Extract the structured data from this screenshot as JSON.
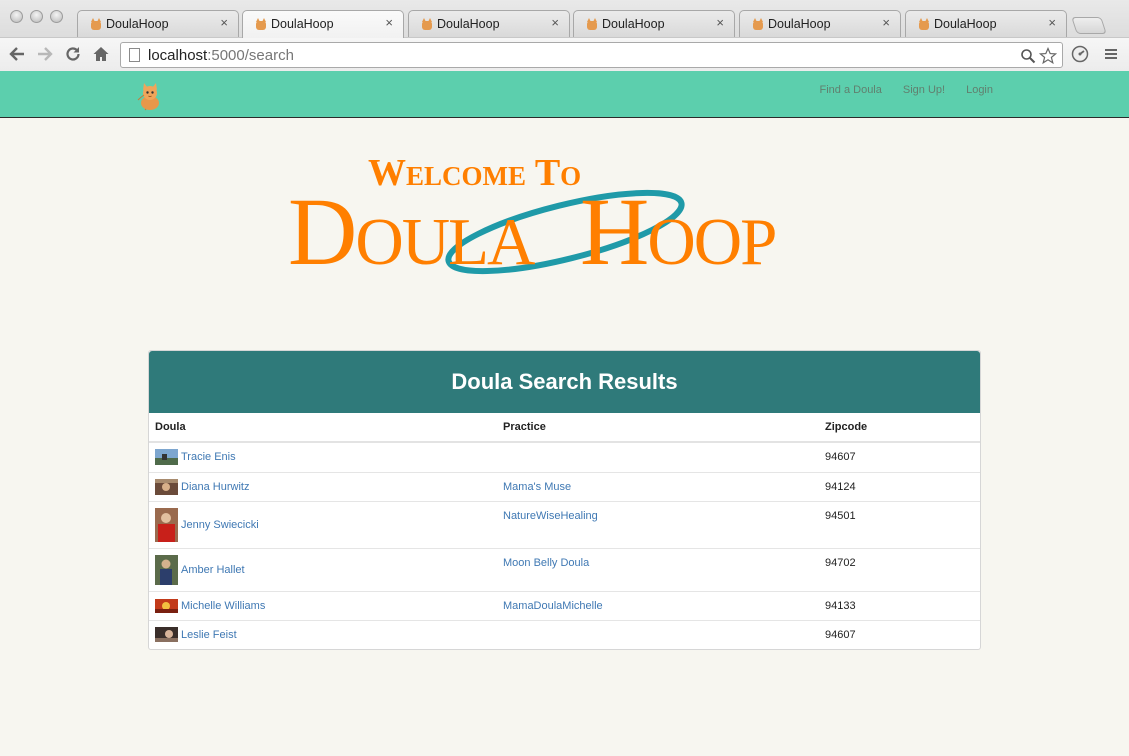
{
  "browser": {
    "tabs": [
      {
        "title": "DoulaHoop",
        "active": false
      },
      {
        "title": "DoulaHoop",
        "active": true
      },
      {
        "title": "DoulaHoop",
        "active": false
      },
      {
        "title": "DoulaHoop",
        "active": false
      },
      {
        "title": "DoulaHoop",
        "active": false
      },
      {
        "title": "DoulaHoop",
        "active": false
      }
    ],
    "tab_close_glyph": "×",
    "url_host": "localhost",
    "url_path": ":5000/search"
  },
  "nav": {
    "links": [
      "Find a Doula",
      "Sign Up!",
      "Login"
    ]
  },
  "hero": {
    "welcome_text": "Welcome To",
    "brand_part1": "Doula",
    "brand_part2": "Hoop"
  },
  "results": {
    "title": "Doula Search Results",
    "columns": [
      "Doula",
      "Practice",
      "Zipcode"
    ],
    "rows": [
      {
        "name": "Tracie Enis",
        "practice": "",
        "zipcode": "94607"
      },
      {
        "name": "Diana Hurwitz",
        "practice": "Mama's Muse",
        "zipcode": "94124"
      },
      {
        "name": "Jenny Swiecicki",
        "practice": "NatureWiseHealing",
        "zipcode": "94501"
      },
      {
        "name": "Amber Hallet",
        "practice": "Moon Belly Doula",
        "zipcode": "94702"
      },
      {
        "name": "Michelle Williams",
        "practice": "MamaDoulaMichelle",
        "zipcode": "94133"
      },
      {
        "name": "Leslie Feist",
        "practice": "",
        "zipcode": "94607"
      }
    ]
  },
  "colors": {
    "nav_bg": "#5ccfad",
    "panel_header": "#2f7a7a",
    "link": "#3f78b3",
    "brand_orange": "#ff7f00",
    "hoop_teal": "#1f9aa8",
    "page_bg": "#f7f6f0"
  }
}
